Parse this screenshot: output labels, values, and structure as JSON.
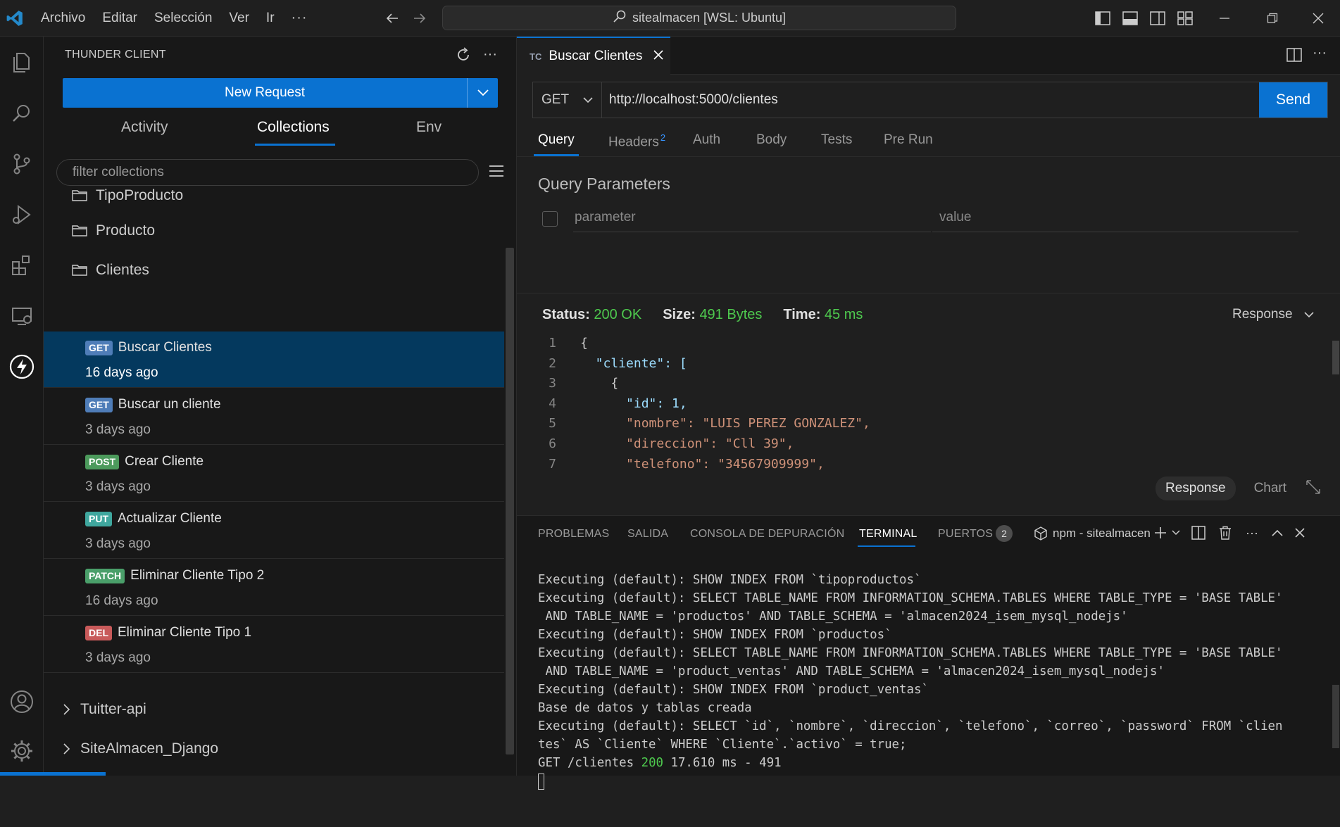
{
  "titlebar": {
    "menu": [
      "Archivo",
      "Editar",
      "Selección",
      "Ver",
      "Ir"
    ],
    "more": "···",
    "search_text": "sitealmacen [WSL: Ubuntu]"
  },
  "sidebar": {
    "title": "THUNDER CLIENT",
    "new_request": "New Request",
    "tabs": [
      "Activity",
      "Collections",
      "Env"
    ],
    "active_tab": "Collections",
    "filter_placeholder": "filter collections",
    "folders": [
      "TipoProducto",
      "Producto",
      "Clientes"
    ],
    "requests": [
      {
        "method": "GET",
        "name": "Buscar Clientes",
        "time": "16 days ago",
        "color": "#4f7db8",
        "selected": true
      },
      {
        "method": "GET",
        "name": "Buscar un cliente",
        "time": "3 days ago",
        "color": "#4f7db8"
      },
      {
        "method": "POST",
        "name": "Crear Cliente",
        "time": "3 days ago",
        "color": "#4c9a5c"
      },
      {
        "method": "PUT",
        "name": "Actualizar Cliente",
        "time": "3 days ago",
        "color": "#3fa79e"
      },
      {
        "method": "PATCH",
        "name": "Eliminar Cliente Tipo 2",
        "time": "16 days ago",
        "color": "#4a9f6a"
      },
      {
        "method": "DEL",
        "name": "Eliminar Cliente Tipo 1",
        "time": "3 days ago",
        "color": "#c85a5a"
      }
    ],
    "groups": [
      "Tuitter-api",
      "SiteAlmacen_Django"
    ]
  },
  "editor": {
    "tab_badge": "TC",
    "tab_label": "Buscar Clientes",
    "method": "GET",
    "url": "http://localhost:5000/clientes",
    "send": "Send",
    "request_tabs": [
      "Query",
      "Headers",
      "Auth",
      "Body",
      "Tests",
      "Pre Run"
    ],
    "headers_count": "2",
    "query_title": "Query Parameters",
    "param_placeholder": "parameter",
    "value_placeholder": "value",
    "status_label": "Status:",
    "status_value": "200 OK",
    "size_label": "Size:",
    "size_value": "491 Bytes",
    "time_label": "Time:",
    "time_value": "45 ms",
    "response_dropdown": "Response",
    "response_btn": "Response",
    "chart_btn": "Chart",
    "code_lines": [
      {
        "n": "1",
        "t": "{"
      },
      {
        "n": "2",
        "t": "  \"cliente\": ["
      },
      {
        "n": "3",
        "t": "    {"
      },
      {
        "n": "4",
        "t": "      \"id\": 1,"
      },
      {
        "n": "5",
        "t": "      \"nombre\": \"LUIS PEREZ GONZALEZ\","
      },
      {
        "n": "6",
        "t": "      \"direccion\": \"Cll 39\","
      },
      {
        "n": "7",
        "t": "      \"telefono\": \"34567909999\","
      }
    ]
  },
  "panel": {
    "tabs": [
      "PROBLEMAS",
      "SALIDA",
      "CONSOLA DE DEPURACIÓN",
      "TERMINAL",
      "PUERTOS"
    ],
    "ports_count": "2",
    "terminal_name": "npm - sitealmacen",
    "terminal_lines": [
      "Executing (default): SHOW INDEX FROM `tipoproductos`",
      "Executing (default): SELECT TABLE_NAME FROM INFORMATION_SCHEMA.TABLES WHERE TABLE_TYPE = 'BASE TABLE'",
      " AND TABLE_NAME = 'productos' AND TABLE_SCHEMA = 'almacen2024_isem_mysql_nodejs'",
      "Executing (default): SHOW INDEX FROM `productos`",
      "Executing (default): SELECT TABLE_NAME FROM INFORMATION_SCHEMA.TABLES WHERE TABLE_TYPE = 'BASE TABLE'",
      " AND TABLE_NAME = 'product_ventas' AND TABLE_SCHEMA = 'almacen2024_isem_mysql_nodejs'",
      "Executing (default): SHOW INDEX FROM `product_ventas`",
      "Base de datos y tablas creada",
      "Executing (default): SELECT `id`, `nombre`, `direccion`, `telefono`, `correo`, `password` FROM `clien",
      "tes` AS `Cliente` WHERE `Cliente`.`activo` = true;"
    ],
    "last_line": {
      "prefix": "GET /clientes ",
      "status": "200",
      "suffix": " 17.610 ms - 491"
    }
  }
}
